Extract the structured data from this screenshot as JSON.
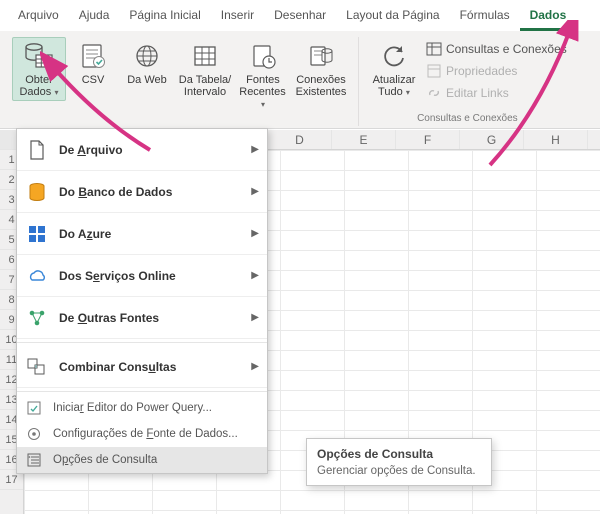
{
  "tabs": {
    "arquivo": "Arquivo",
    "ajuda": "Ajuda",
    "pagina_inicial": "Página Inicial",
    "inserir": "Inserir",
    "desenhar": "Desenhar",
    "layout": "Layout da Página",
    "formulas": "Fórmulas",
    "dados": "Dados"
  },
  "ribbon": {
    "obter_dados": "Obter Dados",
    "csv": "CSV",
    "da_web": "Da Web",
    "da_tabela": "Da Tabela/ Intervalo",
    "fontes_recentes": "Fontes Recentes",
    "conexoes_existentes": "Conexões Existentes",
    "atualizar_tudo": "Atualizar Tudo",
    "consultas_conexoes": "Consultas e Conexões",
    "propriedades": "Propriedades",
    "editar_links": "Editar Links",
    "group2_label": "Consultas e Conexões"
  },
  "menu": {
    "de_arquivo": "De Arquivo",
    "do_banco": "Do Banco de Dados",
    "do_azure": "Do Azure",
    "dos_servicos": "Dos Serviços Online",
    "de_outras": "De Outras Fontes",
    "combinar": "Combinar Consultas",
    "iniciar_editor": "Iniciar Editor do Power Query...",
    "config_fonte": "Configurações de Fonte de Dados...",
    "opcoes_consulta": "Opções de Consulta"
  },
  "tooltip": {
    "title": "Opções de Consulta",
    "body": "Gerenciar opções de Consulta."
  },
  "columns": [
    "D",
    "E",
    "F",
    "G",
    "H"
  ],
  "rows": [
    "1",
    "2",
    "3",
    "4",
    "5",
    "6",
    "7",
    "8",
    "9",
    "10",
    "11",
    "12",
    "13",
    "14",
    "15",
    "16",
    "17"
  ]
}
